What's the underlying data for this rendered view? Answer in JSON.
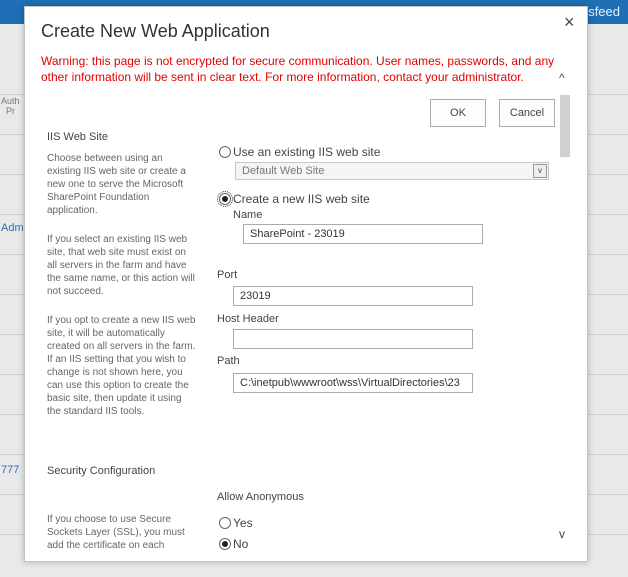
{
  "background": {
    "topbar_text": "sfeed",
    "left_text_1": "Auth",
    "left_text_2": "Pr",
    "left_link_1": "Adm",
    "left_link_2": "777"
  },
  "dialog": {
    "title": "Create New Web Application",
    "close_glyph": "×",
    "warning": "Warning: this page is not encrypted for secure communication. User names, passwords, and any other information will be sent in clear text. For more information, contact your administrator.",
    "ok_label": "OK",
    "cancel_label": "Cancel"
  },
  "iis_section": {
    "title": "IIS Web Site",
    "desc_1": "Choose between using an existing IIS web site or create a new one to serve the Microsoft SharePoint Foundation application.",
    "desc_2": "If you select an existing IIS web site, that web site must exist on all servers in the farm and have the same name, or this action will not succeed.",
    "desc_3": "If you opt to create a new IIS web site, it will be automatically created on all servers in the farm.  If an IIS setting that you wish to change is not shown here, you can use this option to create the basic site, then update it using the standard IIS tools.",
    "use_existing_label": "Use an existing IIS web site",
    "existing_select_value": "Default Web Site",
    "create_new_label": "Create a new IIS web site",
    "name_label": "Name",
    "name_value": "SharePoint - 23019",
    "port_label": "Port",
    "port_value": "23019",
    "host_header_label": "Host Header",
    "host_header_value": "",
    "path_label": "Path",
    "path_value": "C:\\inetpub\\wwwroot\\wss\\VirtualDirectories\\23"
  },
  "security_section": {
    "title": "Security Configuration",
    "desc": "If you choose to use Secure Sockets Layer (SSL), you must add the certificate on each",
    "allow_anonymous_label": "Allow Anonymous",
    "yes_label": "Yes",
    "no_label": "No"
  },
  "icons": {
    "scroll_up": "^",
    "scroll_down": "v",
    "dropdown_arrow": "v"
  }
}
